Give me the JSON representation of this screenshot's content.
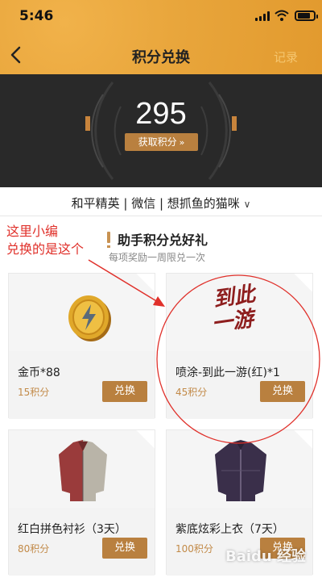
{
  "status_bar": {
    "time": "5:46"
  },
  "nav": {
    "title": "积分兑换",
    "record_label": "记录"
  },
  "points": {
    "value": "295",
    "get_points_label": "获取积分"
  },
  "account": {
    "label": "和平精英 | 微信 | 想抓鱼的猫咪"
  },
  "section": {
    "title": "助手积分兑好礼",
    "subtitle": "每项奖励一周限兑一次"
  },
  "annotation": {
    "line1": "这里小编",
    "line2": "兑换的是这个"
  },
  "items": [
    {
      "name": "金币*88",
      "price": "15积分",
      "button": "兑换"
    },
    {
      "name": "喷涂-到此一游(红)*1",
      "price": "45积分",
      "button": "兑换"
    },
    {
      "name": "红白拼色衬衫（3天）",
      "price": "80积分",
      "button": "兑换"
    },
    {
      "name": "紫底炫彩上衣（7天）",
      "price": "100积分",
      "button": "兑换"
    }
  ],
  "spray_text": {
    "line1": "到此",
    "line2": "一游"
  },
  "watermark": "Baidu 经验",
  "colors": {
    "header": "#e8a53b",
    "accent": "#b9803f",
    "panel": "#292929",
    "annotation": "#e0312b"
  }
}
